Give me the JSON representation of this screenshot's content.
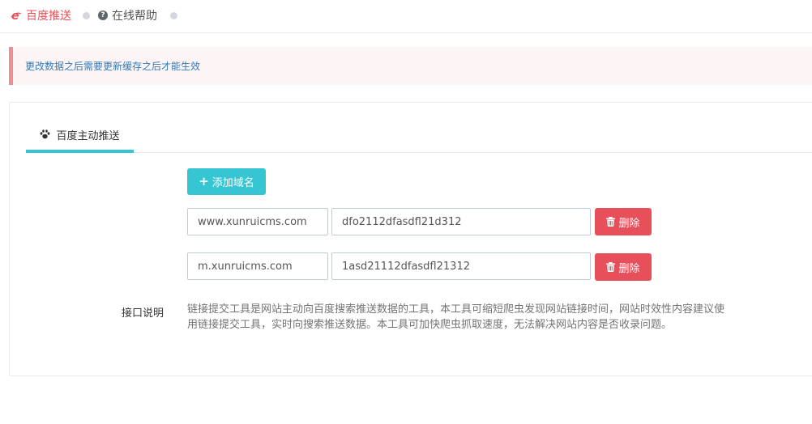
{
  "breadcrumb": {
    "items": [
      {
        "label": "百度推送",
        "icon": "e-logo-icon"
      },
      {
        "label": "在线帮助",
        "icon": "question-circle-icon"
      }
    ]
  },
  "alert": {
    "text": "更改数据之后需要更新缓存之后才能生效"
  },
  "tabs": [
    {
      "label": "百度主动推送",
      "icon": "paw-icon",
      "active": true
    }
  ],
  "form": {
    "add_button_label": "添加域名",
    "rows": [
      {
        "domain": "www.xunruicms.com",
        "token": "dfo2112dfasdfl21d312",
        "delete_label": "删除"
      },
      {
        "domain": "m.xunruicms.com",
        "token": "1asd21112dfasdfl21312",
        "delete_label": "删除"
      }
    ],
    "description_label": "接口说明",
    "description": "链接提交工具是网站主动向百度搜索推送数据的工具，本工具可缩短爬虫发现网站链接时间，网站时效性内容建议使用链接提交工具，实时向搜索推送数据。本工具可加快爬虫抓取速度，无法解决网站内容是否收录问题。"
  },
  "colors": {
    "brand_red": "#e7505a",
    "accent_teal": "#36c6d3",
    "alert_text": "#337ab7"
  }
}
